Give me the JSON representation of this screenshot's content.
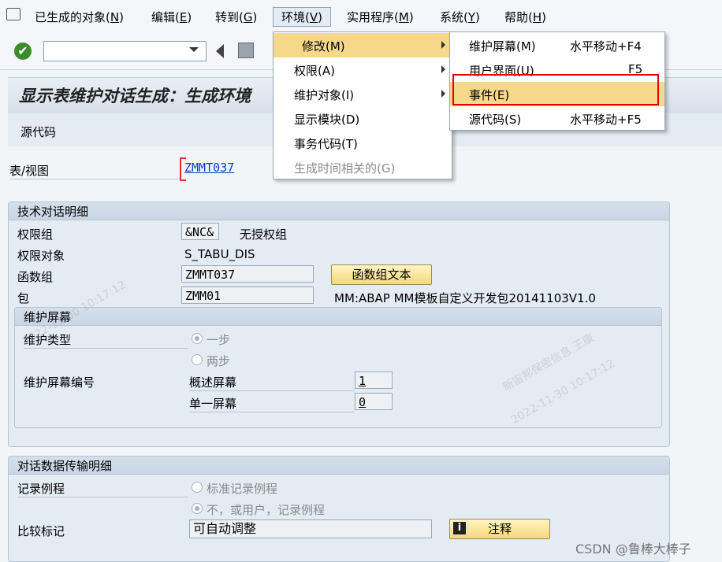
{
  "menubar": {
    "items": [
      {
        "label": "已生成的对象(",
        "key": "N",
        "suffix": ")"
      },
      {
        "label": "编辑(",
        "key": "E",
        "suffix": ")"
      },
      {
        "label": "转到(",
        "key": "G",
        "suffix": ")"
      },
      {
        "label": "环境(",
        "key": "V",
        "suffix": ")"
      },
      {
        "label": "实用程序(",
        "key": "M",
        "suffix": ")"
      },
      {
        "label": "系统(",
        "key": "Y",
        "suffix": ")"
      },
      {
        "label": "帮助(",
        "key": "H",
        "suffix": ")"
      }
    ]
  },
  "toolbar": {
    "command_value": ""
  },
  "title": "显示表维护对话生成：生成环境",
  "app_toolbar": {
    "source_code": "源代码"
  },
  "table_view": {
    "label": "表/视图",
    "value": "ZMMT037"
  },
  "tech_panel": {
    "heading": "技术对话明细",
    "auth_group_label": "权限组",
    "auth_group_value": "&NC&",
    "auth_group_text": "无授权组",
    "auth_object_label": "权限对象",
    "auth_object_value": "S_TABU_DIS",
    "func_group_label": "函数组",
    "func_group_value": "ZMMT037",
    "func_group_button": "函数组文本",
    "package_label": "包",
    "package_value": "ZMM01",
    "package_text": "MM:ABAP MM模板自定义开发包20141103V1.0"
  },
  "screen_panel": {
    "heading": "维护屏幕",
    "type_label": "维护类型",
    "opt_one": "一步",
    "opt_two": "两步",
    "number_label": "维护屏幕编号",
    "overview_label": "概述屏幕",
    "overview_value": "1",
    "single_label": "单一屏幕",
    "single_value": "0"
  },
  "transport_panel": {
    "heading": "对话数据传输明细",
    "routine_label": "记录例程",
    "opt_standard": "标准记录例程",
    "opt_no": "不，或用户，记录例程",
    "compare_label": "比较标记",
    "compare_value": "可自动调整",
    "note_button": "注释"
  },
  "env_menu": {
    "items": [
      {
        "label": "修改(M)",
        "submenu": true
      },
      {
        "label": "权限(A)",
        "submenu": true
      },
      {
        "label": "维护对象(I)",
        "submenu": true
      },
      {
        "label": "显示模块(D)"
      },
      {
        "label": "事务代码(T)"
      },
      {
        "label": "生成时间相关的(G)",
        "disabled": true
      }
    ]
  },
  "sub_menu": {
    "items": [
      {
        "label": "维护屏幕(M)",
        "shortcut": "水平移动+F4"
      },
      {
        "label": "用户界面(U)",
        "shortcut": "F5"
      },
      {
        "label": "事件(E)",
        "shortcut": ""
      },
      {
        "label": "源代码(S)",
        "shortcut": "水平移动+F5"
      }
    ]
  },
  "watermark": {
    "text1": "新宙邦保密信息 王康",
    "text2": "2022-11-30 10:17:12"
  },
  "footer_credit": "CSDN @鲁棒大棒子",
  "colors": {
    "highlight": "#f6d88a",
    "callout": "#e00000"
  }
}
